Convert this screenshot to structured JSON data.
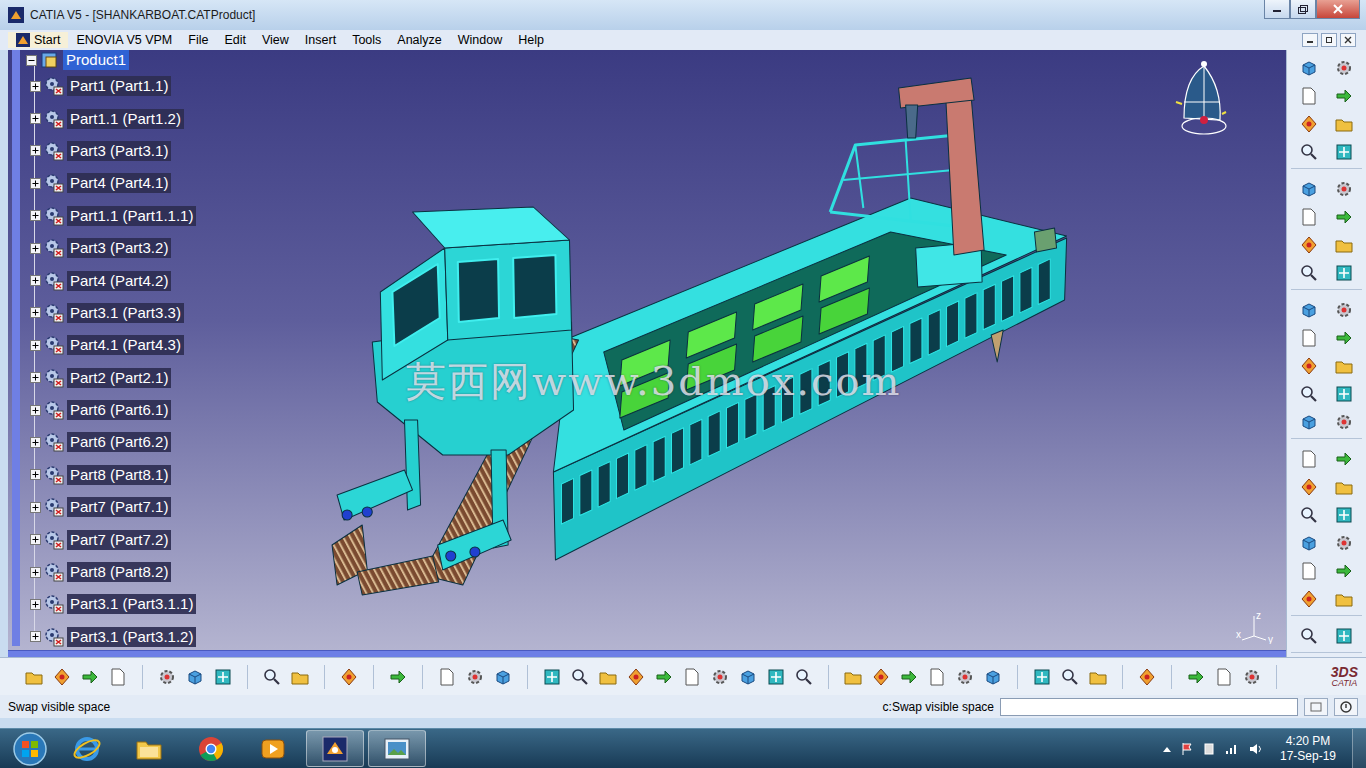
{
  "window": {
    "title": "CATIA V5 - [SHANKARBOAT.CATProduct]"
  },
  "menu": [
    {
      "label": "Start"
    },
    {
      "label": "ENOVIA V5 VPM"
    },
    {
      "label": "File"
    },
    {
      "label": "Edit"
    },
    {
      "label": "View"
    },
    {
      "label": "Insert"
    },
    {
      "label": "Tools"
    },
    {
      "label": "Analyze"
    },
    {
      "label": "Window"
    },
    {
      "label": "Help"
    }
  ],
  "tree": {
    "root": {
      "label": "Product1",
      "selected": true,
      "expanded": true
    },
    "items": [
      {
        "label": "Part1 (Part1.1)",
        "selected": false,
        "expanded": false
      },
      {
        "label": "Part1.1 (Part1.2)",
        "selected": false,
        "expanded": false
      },
      {
        "label": "Part3 (Part3.1)",
        "selected": false,
        "expanded": false
      },
      {
        "label": "Part4 (Part4.1)",
        "selected": false,
        "expanded": false
      },
      {
        "label": "Part1.1 (Part1.1.1)",
        "selected": false,
        "expanded": false
      },
      {
        "label": "Part3 (Part3.2)",
        "selected": false,
        "expanded": false
      },
      {
        "label": "Part4 (Part4.2)",
        "selected": false,
        "expanded": false
      },
      {
        "label": "Part3.1 (Part3.3)",
        "selected": false,
        "expanded": false
      },
      {
        "label": "Part4.1 (Part4.3)",
        "selected": false,
        "expanded": false
      },
      {
        "label": "Part2 (Part2.1)",
        "selected": false,
        "expanded": false
      },
      {
        "label": "Part6 (Part6.1)",
        "selected": false,
        "expanded": false
      },
      {
        "label": "Part6 (Part6.2)",
        "selected": false,
        "expanded": false
      },
      {
        "label": "Part8 (Part8.1)",
        "selected": false,
        "expanded": false
      },
      {
        "label": "Part7 (Part7.1)",
        "selected": false,
        "expanded": false
      },
      {
        "label": "Part7 (Part7.2)",
        "selected": false,
        "expanded": false
      },
      {
        "label": "Part8 (Part8.2)",
        "selected": false,
        "expanded": false
      },
      {
        "label": "Part3.1 (Part3.1.1)",
        "selected": false,
        "expanded": false
      },
      {
        "label": "Part3.1 (Part3.1.2)",
        "selected": false,
        "expanded": false
      }
    ]
  },
  "watermark": "莫西网www.3dmox.com",
  "axis_labels": {
    "x": "x",
    "y": "y",
    "z": "z"
  },
  "logo": {
    "mark": "3DS",
    "name": "CATIA"
  },
  "status_bar": {
    "message": "Swap visible space",
    "command": "c:Swap visible space",
    "input": ""
  },
  "taskbar": {
    "apps": [
      {
        "kind": "ie",
        "active": false
      },
      {
        "kind": "explorer",
        "active": false
      },
      {
        "kind": "chrome",
        "active": false
      },
      {
        "kind": "media",
        "active": false
      },
      {
        "kind": "catia",
        "active": true
      },
      {
        "kind": "viewer",
        "active": true
      }
    ],
    "time": "4:20 PM",
    "date": "17-Sep-19"
  }
}
